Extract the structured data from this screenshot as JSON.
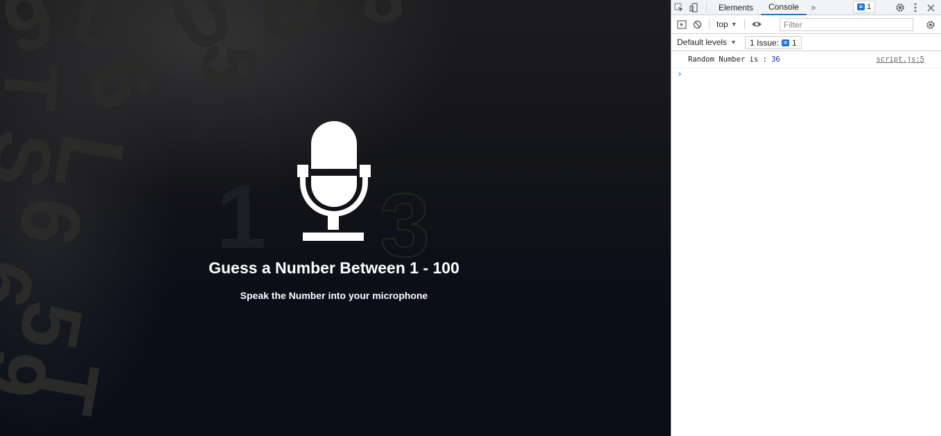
{
  "page": {
    "title": "Guess a Number Between 1 - 100",
    "subtitle": "Speak the Number into your microphone",
    "mic_icon": "microphone-icon",
    "colors": {
      "background": "#0b0e18",
      "text": "#ffffff"
    }
  },
  "devtools": {
    "tabs": [
      {
        "label": "Elements",
        "active": false
      },
      {
        "label": "Console",
        "active": true
      }
    ],
    "more_tabs_glyph": "»",
    "issues_badge_count": "1",
    "context": "top",
    "filter_placeholder": "Filter",
    "levels_label": "Default levels",
    "issue_button_label": "1 Issue:",
    "issue_button_count": "1",
    "console": {
      "message_text": "Random Number is : ",
      "message_value": "36",
      "source": "script.js:5",
      "prompt": "›"
    },
    "colors": {
      "accent": "#1a73e8",
      "number": "#1a1aa6"
    }
  }
}
